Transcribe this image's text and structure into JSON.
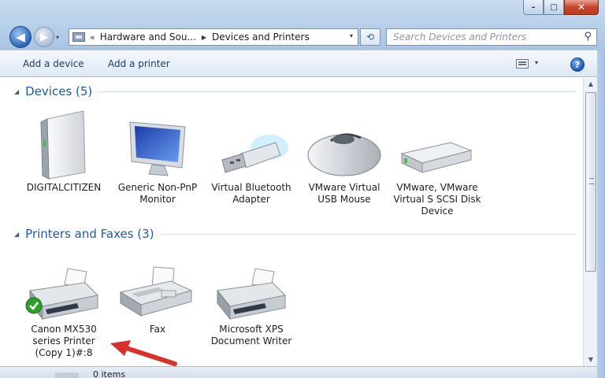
{
  "window": {
    "controls": {
      "minimize": "–",
      "maximize": "□",
      "close": "✕"
    }
  },
  "nav": {
    "back_icon": "arrow-left-icon",
    "forward_icon": "arrow-right-icon",
    "back_glyph": "◀",
    "forward_glyph": "▶",
    "dropdown_glyph": "▾"
  },
  "address": {
    "root_glyph": "«",
    "crumbs": [
      "Hardware and Sou...",
      "Devices and Printers"
    ],
    "sep_glyph": "▶",
    "dropdown_glyph": "▾",
    "refresh_glyph": "⟲"
  },
  "search": {
    "placeholder": "Search Devices and Printers",
    "icon_glyph": "⚲"
  },
  "toolbar": {
    "add_device": "Add a device",
    "add_printer": "Add a printer",
    "view_dropdown_glyph": "▾",
    "help_glyph": "?"
  },
  "groups": {
    "devices": {
      "title": "Devices (5)",
      "collapse_glyph": "◢",
      "items": [
        {
          "label": "DIGITALCITIZEN",
          "icon": "computer-tower-icon"
        },
        {
          "label": "Generic Non-PnP Monitor",
          "icon": "monitor-icon"
        },
        {
          "label": "Virtual Bluetooth Adapter",
          "icon": "bluetooth-adapter-icon"
        },
        {
          "label": "VMware Virtual USB Mouse",
          "icon": "mouse-icon"
        },
        {
          "label": "VMware, VMware Virtual S SCSI Disk Device",
          "icon": "hard-disk-icon"
        }
      ]
    },
    "printers": {
      "title": "Printers and Faxes (3)",
      "collapse_glyph": "◢",
      "items": [
        {
          "label": "Canon MX530 series Printer (Copy 1)#:8",
          "icon": "printer-icon",
          "default": true
        },
        {
          "label": "Fax",
          "icon": "fax-icon"
        },
        {
          "label": "Microsoft XPS Document Writer",
          "icon": "printer-icon"
        }
      ]
    }
  },
  "status": {
    "count": "0 items"
  },
  "colors": {
    "accent": "#1e5aa8",
    "annotation_arrow": "#d8312c",
    "default_check": "#2e9d2c"
  }
}
